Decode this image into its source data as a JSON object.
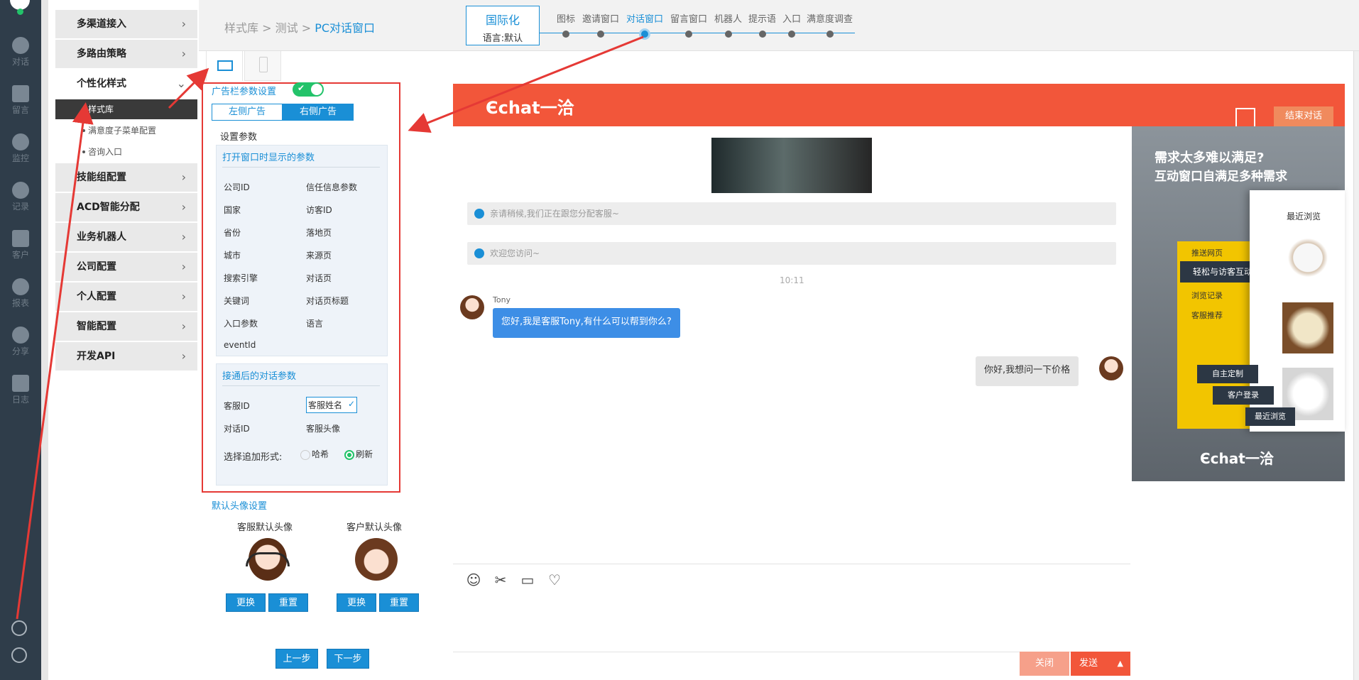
{
  "leftbar": {
    "items": [
      {
        "label": "对话",
        "icon": "chat-icon"
      },
      {
        "label": "留言",
        "icon": "mail-icon"
      },
      {
        "label": "监控",
        "icon": "eye-icon"
      },
      {
        "label": "记录",
        "icon": "clock-icon"
      },
      {
        "label": "客户",
        "icon": "contact-card-icon"
      },
      {
        "label": "报表",
        "icon": "pie-chart-icon"
      },
      {
        "label": "分享",
        "icon": "share-icon"
      },
      {
        "label": "日志",
        "icon": "document-icon"
      }
    ]
  },
  "sidenav": {
    "items": [
      {
        "label": "多渠道接入",
        "chevron": "›"
      },
      {
        "label": "多路由策略",
        "chevron": "›"
      },
      {
        "label": "个性化样式",
        "chevron": "⌄"
      },
      {
        "label": "技能组配置",
        "chevron": "›"
      },
      {
        "label": "ACD智能分配",
        "chevron": "›"
      },
      {
        "label": "业务机器人",
        "chevron": "›"
      },
      {
        "label": "公司配置",
        "chevron": "›"
      },
      {
        "label": "个人配置",
        "chevron": "›"
      },
      {
        "label": "智能配置",
        "chevron": "›"
      },
      {
        "label": "开发API",
        "chevron": "›"
      }
    ],
    "subitems": [
      {
        "label": "样式库",
        "active": true
      },
      {
        "label": "满意度子菜单配置",
        "active": false
      },
      {
        "label": "咨询入口",
        "active": false
      }
    ]
  },
  "breadcrumb": {
    "part1": "样式库",
    "sep": " > ",
    "part2": "测试",
    "part3": "PC对话窗口"
  },
  "intl": {
    "title": "国际化",
    "lang": "语言:默认"
  },
  "steps": [
    "图标",
    "邀请窗口",
    "对话窗口",
    "留言窗口",
    "机器人",
    "提示语",
    "入口",
    "满意度调查"
  ],
  "active_step": 2,
  "settings": {
    "ad_title": "广告栏参数设置",
    "ad_tabs": {
      "left": "左侧广告",
      "right": "右侧广告"
    },
    "setup_label": "设置参数",
    "open_panel": {
      "title": "打开窗口时显示的参数",
      "params": [
        "公司ID",
        "信任信息参数",
        "国家",
        "访客ID",
        "省份",
        "落地页",
        "城市",
        "来源页",
        "搜索引擎",
        "对话页",
        "关键词",
        "对话页标题",
        "入口参数",
        "语言",
        "eventId"
      ]
    },
    "after_panel": {
      "title": "接通后的对话参数",
      "params": [
        "客服ID",
        "客服姓名",
        "对话ID",
        "客服头像"
      ],
      "append_label": "选择追加形式:",
      "options": [
        "哈希",
        "刷新"
      ],
      "selected": "刷新"
    },
    "avatar_title": "默认头像设置",
    "agent_avatar_label": "客服默认头像",
    "customer_avatar_label": "客户默认头像",
    "change_btn": "更换",
    "reset_btn": "重置",
    "prev_btn": "上一步",
    "next_btn": "下一步"
  },
  "chat": {
    "logo_text": "Єchat一洽",
    "end_btn": "结束对话",
    "sys_msgs": [
      "亲请稍候,我们正在跟您分配客服~",
      "欢迎您访问~"
    ],
    "time": "10:11",
    "agent_name": "Tony",
    "agent_msg": "您好,我是客服Tony,有什么可以帮到你么?",
    "visitor_msg": "你好,我想问一下价格",
    "close_btn": "关闭",
    "send_btn": "发送",
    "send_caret": "▲"
  },
  "ad": {
    "headline1": "需求太多难以满足?",
    "headline2": "互动窗口自满足多种需求",
    "recent": "最近浏览",
    "menu": [
      "推送网页",
      "轻松与访客互动",
      "浏览记录",
      "客服推荐",
      "自主定制",
      "客户登录",
      "最近浏览"
    ],
    "brand": "Єchat一洽"
  },
  "colors": {
    "accent": "#1a8fd6",
    "header": "#f2563a",
    "annotation": "#e53935",
    "leftbar": "#2f3d4a"
  }
}
